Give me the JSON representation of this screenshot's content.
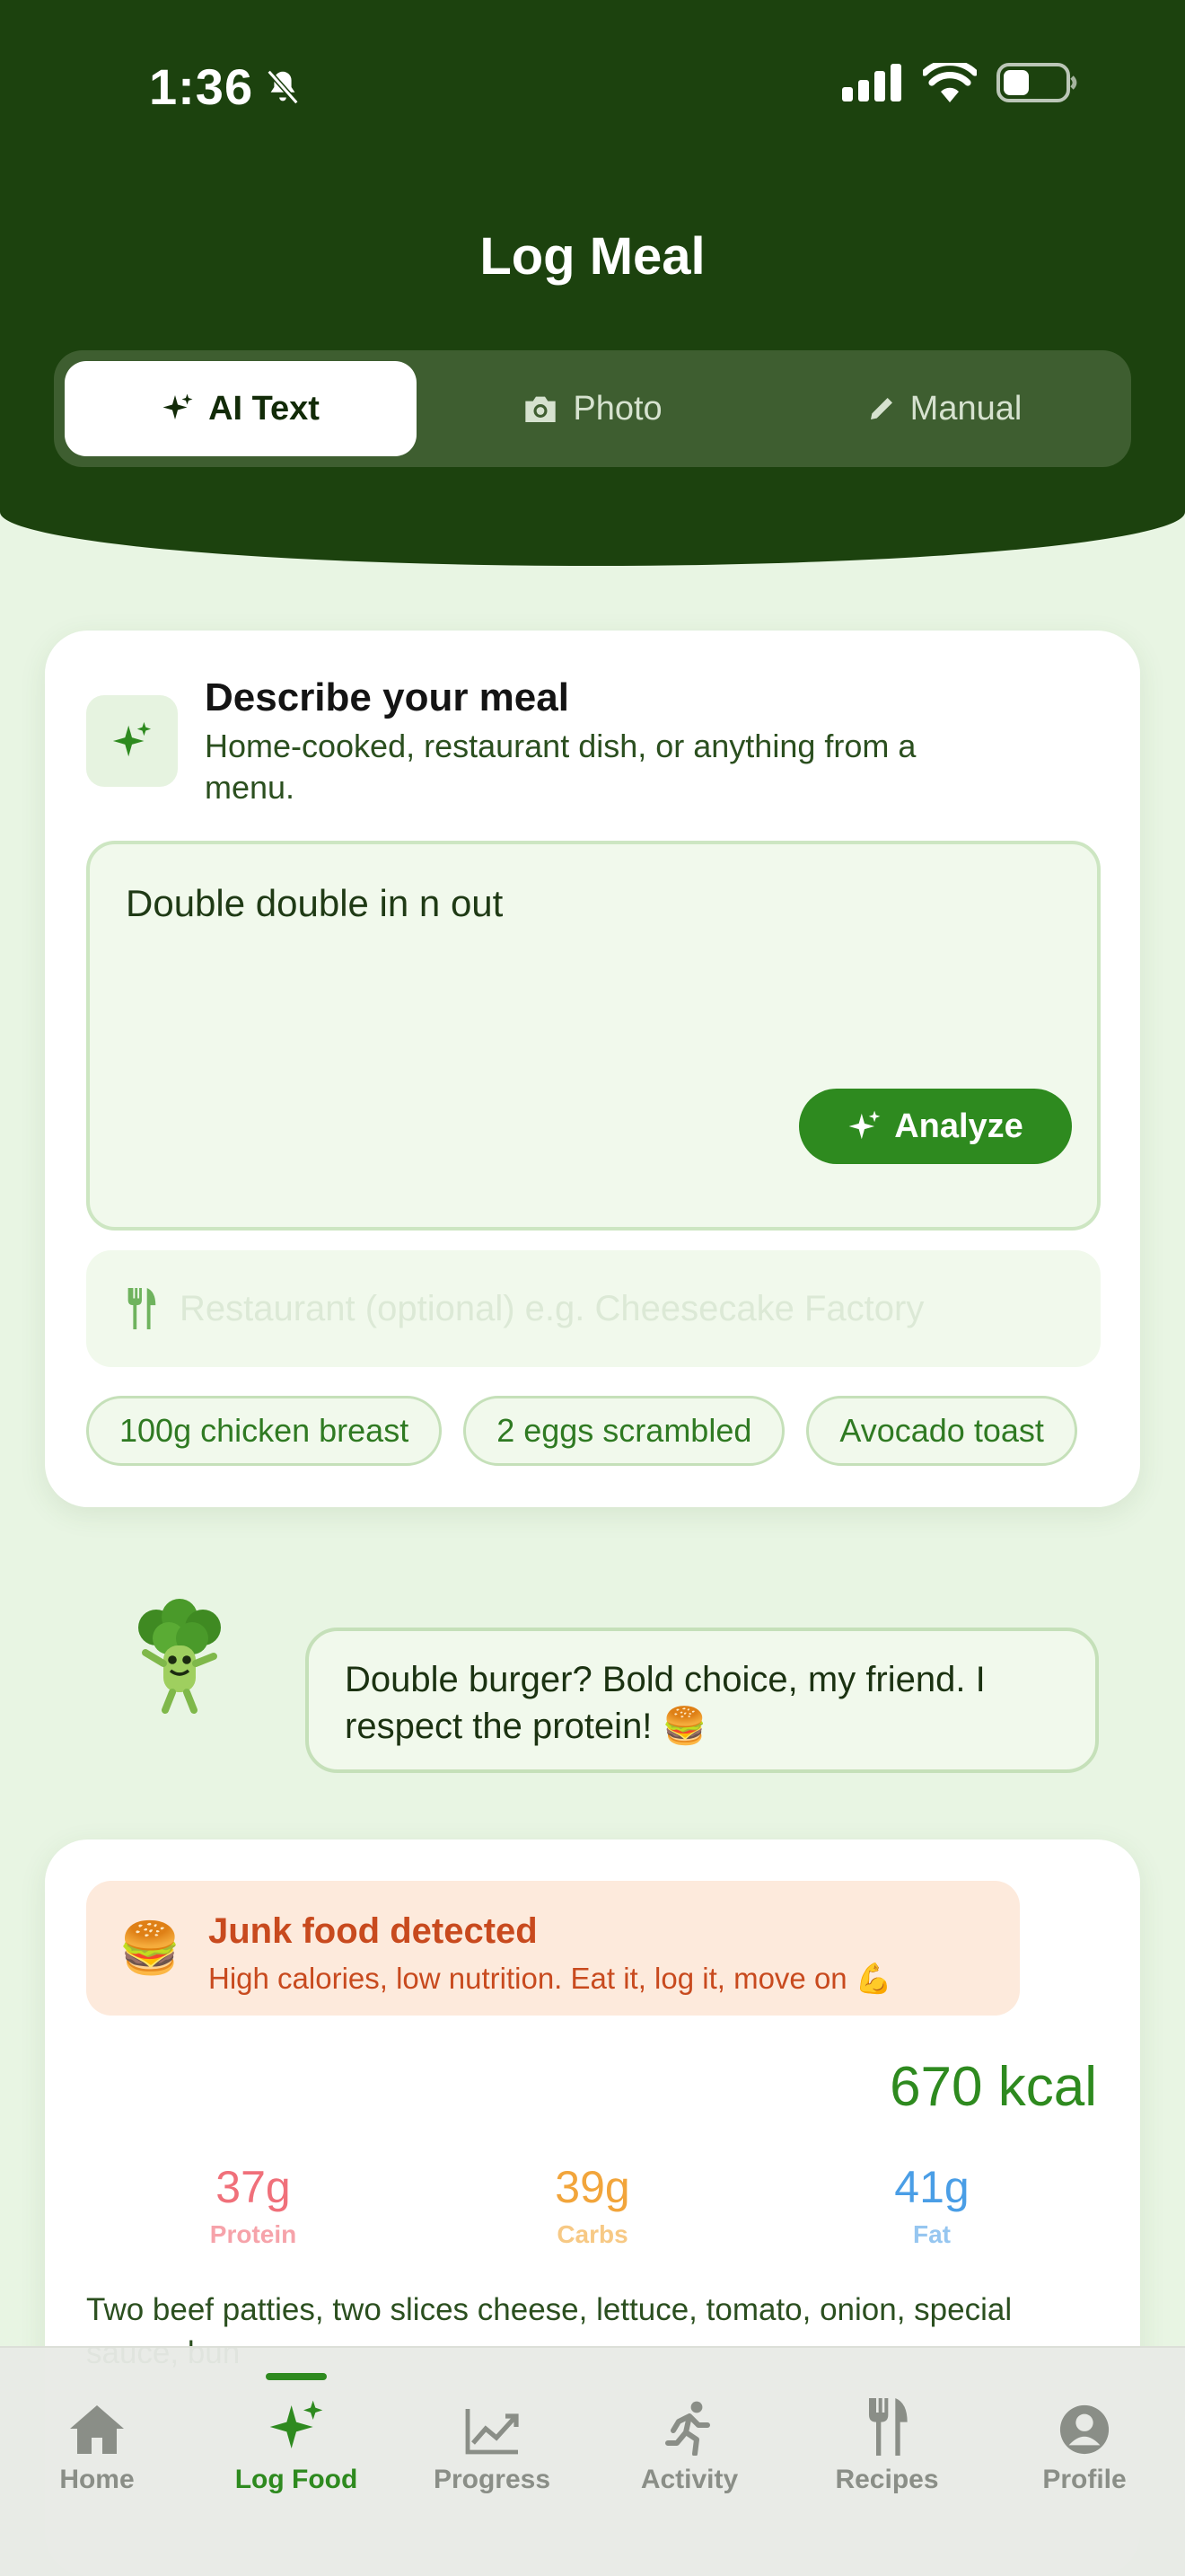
{
  "status_bar": {
    "time": "1:36",
    "icons": [
      "bell-slash-icon",
      "cellular-signal-icon",
      "wifi-icon",
      "battery-icon"
    ]
  },
  "header": {
    "title": "Log Meal",
    "tabs": [
      {
        "label": "AI Text",
        "icon": "sparkle-icon",
        "active": true
      },
      {
        "label": "Photo",
        "icon": "camera-icon",
        "active": false
      },
      {
        "label": "Manual",
        "icon": "pencil-icon",
        "active": false
      }
    ]
  },
  "describe_card": {
    "title": "Describe your meal",
    "subtitle": "Home-cooked, restaurant dish, or anything from a menu.",
    "meal_input_value": "Double double in n out",
    "analyze_label": "Analyze",
    "restaurant_placeholder": "Restaurant (optional) e.g. Cheesecake Factory",
    "suggestions": [
      "100g chicken breast",
      "2 eggs scrambled",
      "Avocado toast"
    ]
  },
  "mascot": {
    "message": "Double burger? Bold choice, my friend. I respect the protein! 🍔"
  },
  "result_card": {
    "alert_emoji": "🍔",
    "alert_title": "Junk food detected",
    "alert_subtitle": "High calories, low nutrition. Eat it, log it, move on 💪",
    "calories": "670 kcal",
    "macros": [
      {
        "value": "37g",
        "label": "Protein",
        "color": "#f0707a",
        "label_color": "#f6a3aa"
      },
      {
        "value": "39g",
        "label": "Carbs",
        "color": "#f2a53b",
        "label_color": "#f7c985"
      },
      {
        "value": "41g",
        "label": "Fat",
        "color": "#4a9ee6",
        "label_color": "#96c6f0"
      }
    ],
    "description": "Two beef patties, two slices cheese, lettuce, tomato, onion, special sauce, bun"
  },
  "bottom_nav": {
    "items": [
      {
        "label": "Home",
        "icon": "home-icon",
        "active": false
      },
      {
        "label": "Log Food",
        "icon": "sparkle-icon",
        "active": true
      },
      {
        "label": "Progress",
        "icon": "chart-icon",
        "active": false
      },
      {
        "label": "Activity",
        "icon": "running-icon",
        "active": false
      },
      {
        "label": "Recipes",
        "icon": "fork-knife-icon",
        "active": false
      },
      {
        "label": "Profile",
        "icon": "person-icon",
        "active": false
      }
    ]
  },
  "colors": {
    "header_bg": "#1c420e",
    "accent": "#2e8a1f",
    "page_bg": "#e8f5e3"
  }
}
